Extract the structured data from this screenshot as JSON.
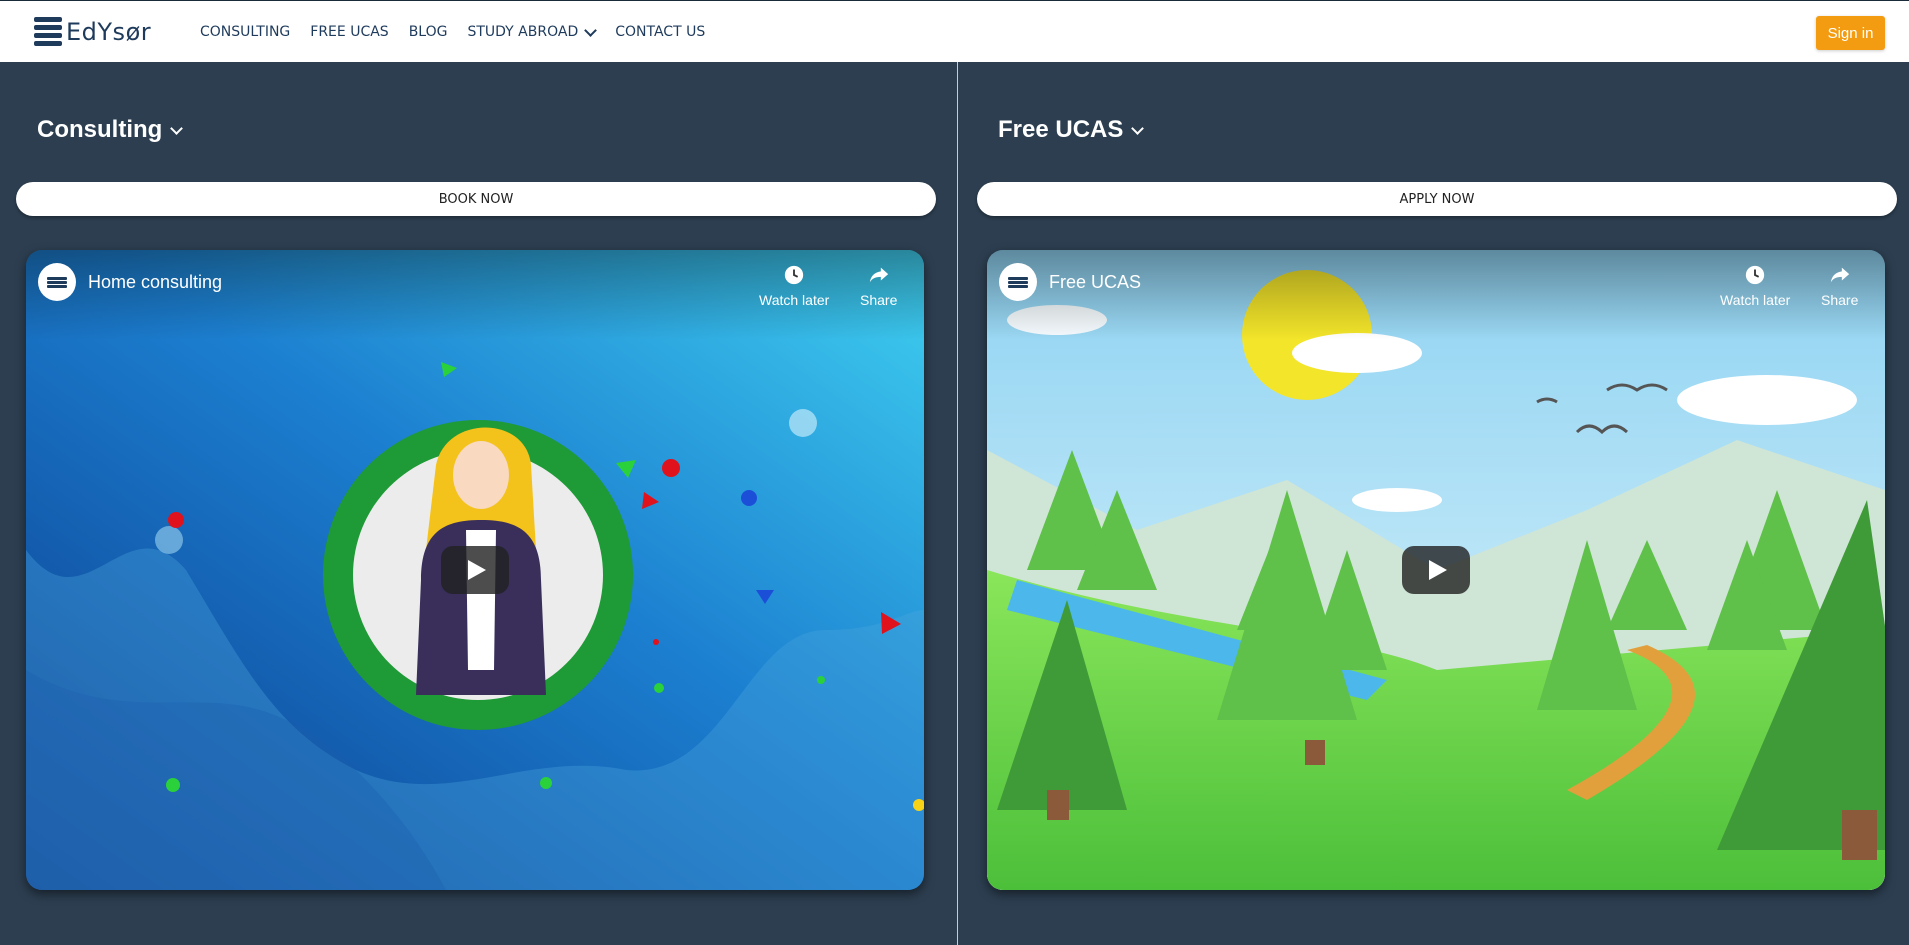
{
  "header": {
    "logo_text": "EdYsør",
    "nav": [
      {
        "label": "CONSULTING"
      },
      {
        "label": "FREE UCAS"
      },
      {
        "label": "BLOG"
      },
      {
        "label": "STUDY ABROAD"
      },
      {
        "label": "CONTACT US"
      }
    ],
    "signin_label": "Sign in"
  },
  "panels": [
    {
      "title": "Consulting",
      "button_label": "BOOK NOW",
      "video": {
        "title": "Home consulting",
        "watch_later": "Watch later",
        "share": "Share"
      }
    },
    {
      "title": "Free UCAS",
      "button_label": "APPLY NOW",
      "video": {
        "title": "Free UCAS",
        "watch_later": "Watch later",
        "share": "Share"
      }
    }
  ],
  "colors": {
    "background": "#2c3e50",
    "signin": "#f39c12",
    "nav_text": "#1f3b5c"
  }
}
